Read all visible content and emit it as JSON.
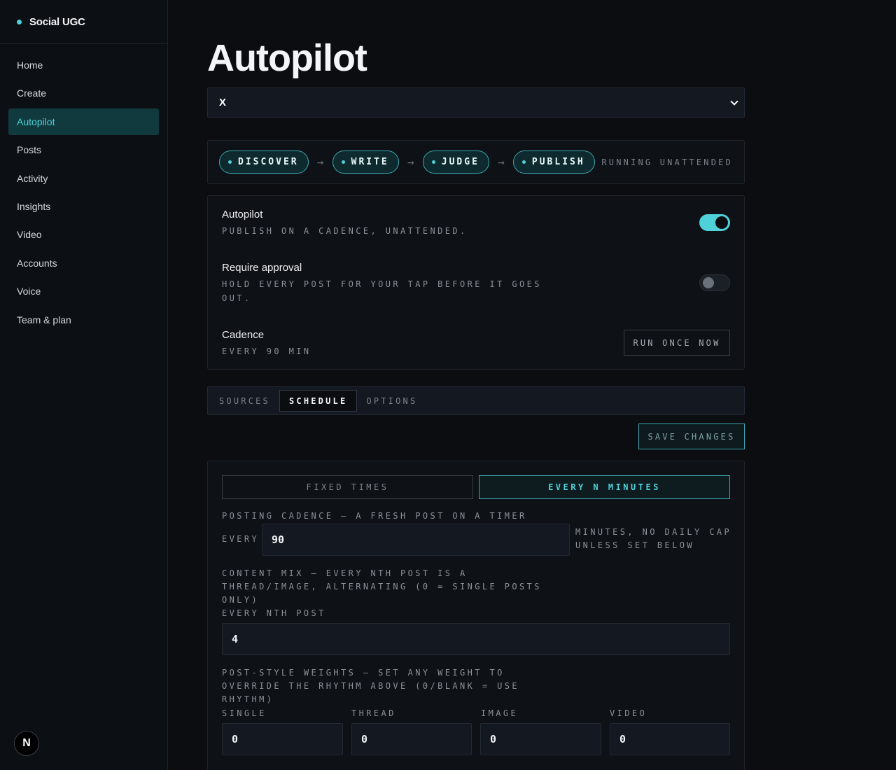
{
  "brand": {
    "name": "Social UGC"
  },
  "nav": [
    {
      "label": "Home"
    },
    {
      "label": "Create"
    },
    {
      "label": "Autopilot"
    },
    {
      "label": "Posts"
    },
    {
      "label": "Activity"
    },
    {
      "label": "Insights"
    },
    {
      "label": "Video"
    },
    {
      "label": "Accounts"
    },
    {
      "label": "Voice"
    },
    {
      "label": "Team & plan"
    }
  ],
  "avatar": {
    "initial": "N"
  },
  "page": {
    "title": "Autopilot"
  },
  "platform_select": {
    "value": "X"
  },
  "pipeline": {
    "steps": [
      "DISCOVER",
      "WRITE",
      "JUDGE",
      "PUBLISH"
    ],
    "arrow": "→",
    "status": "RUNNING UNATTENDED"
  },
  "settings": {
    "autopilot": {
      "title": "Autopilot",
      "subtitle": "PUBLISH ON A CADENCE, UNATTENDED.",
      "enabled": true
    },
    "approval": {
      "title": "Require approval",
      "subtitle_line1": "HOLD EVERY POST FOR YOUR TAP BEFORE IT GOES",
      "subtitle_line2": "OUT.",
      "enabled": false
    },
    "cadence": {
      "title": "Cadence",
      "subtitle": "EVERY 90 MIN",
      "button": "RUN ONCE NOW"
    }
  },
  "tabs": [
    {
      "label": "SOURCES"
    },
    {
      "label": "SCHEDULE",
      "active": true
    },
    {
      "label": "OPTIONS"
    }
  ],
  "save_button": "SAVE CHANGES",
  "schedule": {
    "modes": {
      "fixed": "FIXED TIMES",
      "every": "EVERY N MINUTES",
      "selected": "every"
    },
    "cadence_label": "POSTING CADENCE — A FRESH POST ON A TIMER",
    "every_prefix": "EVERY",
    "minutes_value": "90",
    "minutes_suffix_1": "MINUTES, NO DAILY CAP",
    "minutes_suffix_2": "UNLESS SET BELOW",
    "mix_label_1": "CONTENT MIX — EVERY NTH POST IS A",
    "mix_label_2": "THREAD/IMAGE, ALTERNATING (0 = SINGLE POSTS",
    "mix_label_3": "ONLY)",
    "mix_field_label": "EVERY NTH POST",
    "mix_value": "4",
    "weights_label_1": "POST-STYLE WEIGHTS — SET ANY WEIGHT TO",
    "weights_label_2": "OVERRIDE THE RHYTHM ABOVE (0/BLANK = USE",
    "weights_label_3": "RHYTHM)",
    "weights": [
      {
        "label": "SINGLE",
        "value": "0"
      },
      {
        "label": "THREAD",
        "value": "0"
      },
      {
        "label": "IMAGE",
        "value": "0"
      },
      {
        "label": "VIDEO",
        "value": "0"
      }
    ]
  },
  "colors": {
    "accent": "#4fd1d9",
    "background": "#0b0d11",
    "active_nav_bg": "#113a3e"
  }
}
